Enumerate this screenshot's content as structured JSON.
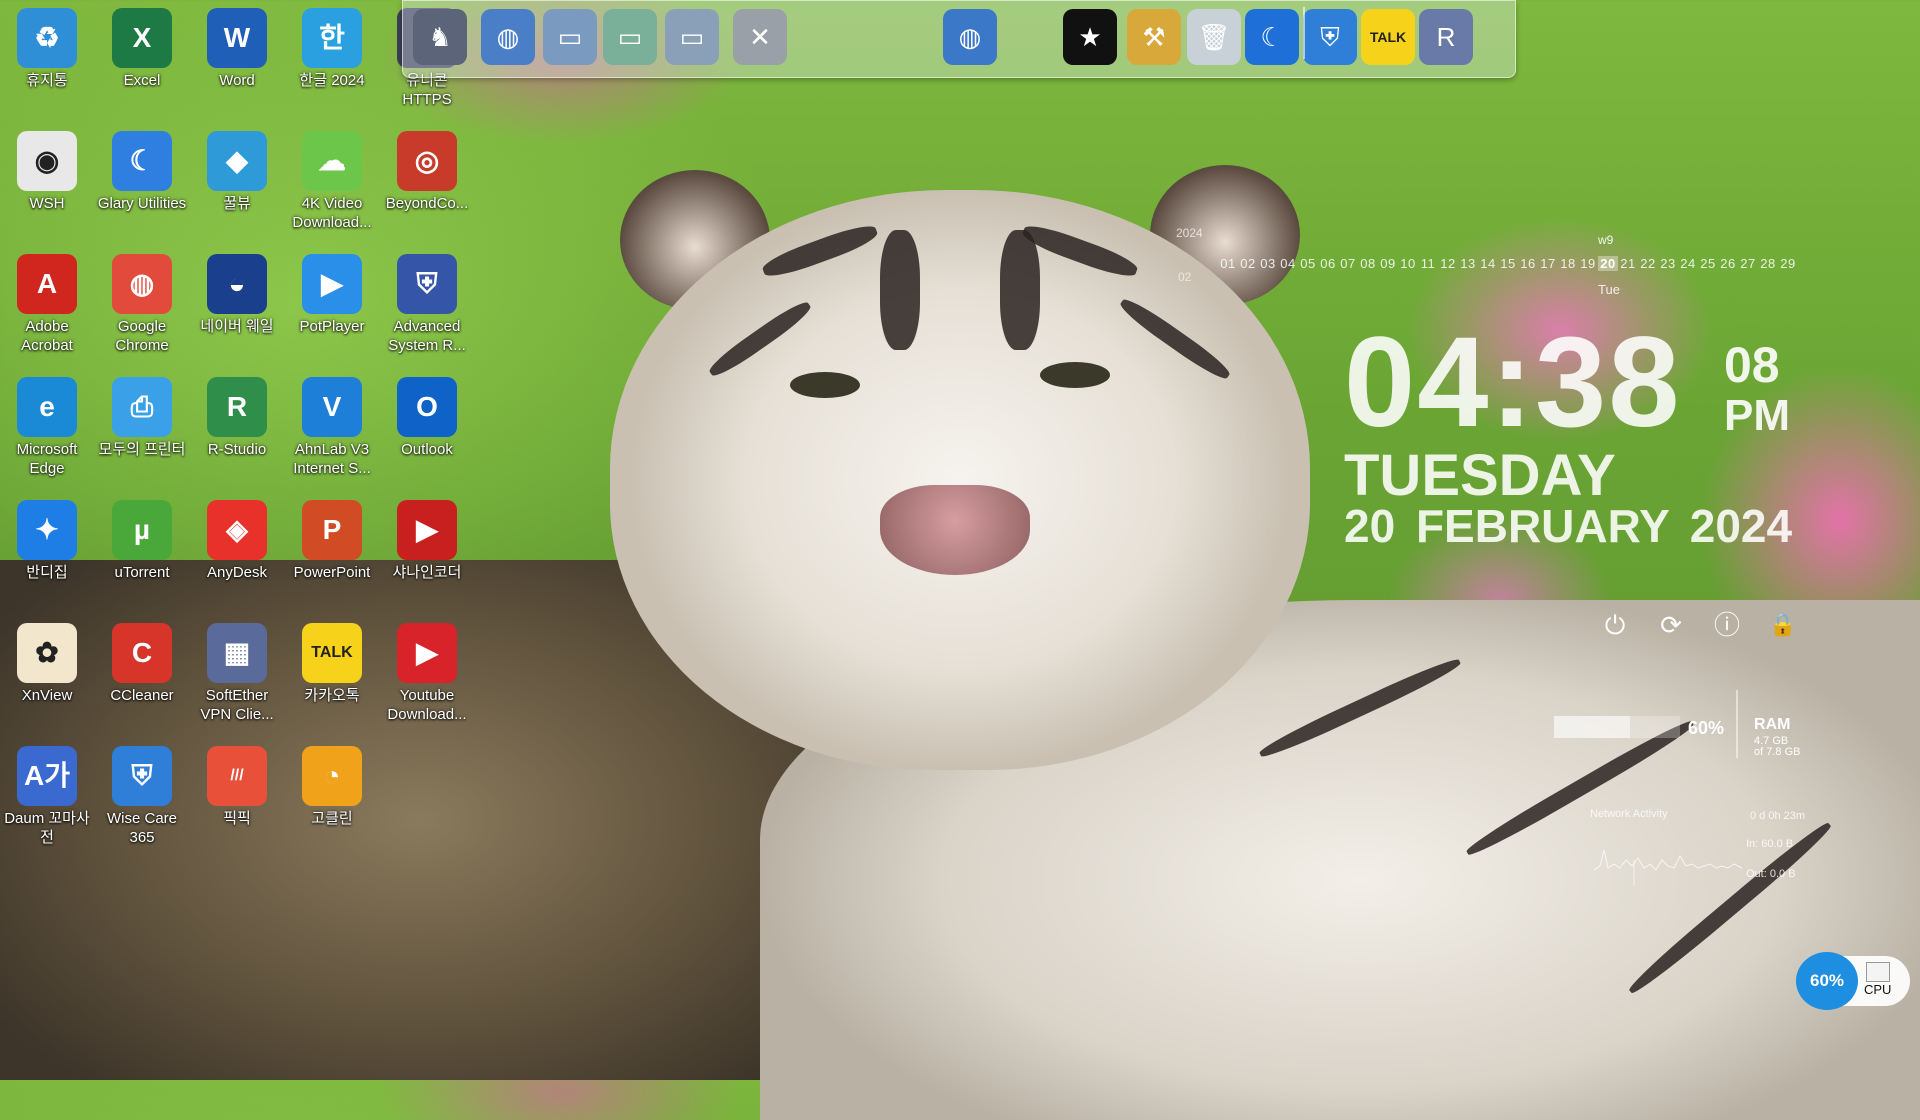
{
  "desktop_icons": [
    {
      "label": "휴지통",
      "icon": "recycle-bin-icon",
      "color": "#2f8fd6",
      "glyph": "♻"
    },
    {
      "label": "Excel",
      "icon": "excel-icon",
      "color": "#1d7a44",
      "glyph": "X"
    },
    {
      "label": "Word",
      "icon": "word-icon",
      "color": "#1f5fb8",
      "glyph": "W"
    },
    {
      "label": "한글 2024",
      "icon": "hangul-icon",
      "color": "#2aa0e0",
      "glyph": "한"
    },
    {
      "label": "유니콘 HTTPS",
      "icon": "unicorn-https-icon",
      "color": "#3a3f58",
      "glyph": "♞"
    },
    {
      "label": "WSH",
      "icon": "wsh-icon",
      "color": "#e8e8e8",
      "glyph": "◉"
    },
    {
      "label": "Glary Utilities",
      "icon": "glary-utilities-icon",
      "color": "#2f7fe0",
      "glyph": "☾"
    },
    {
      "label": "꿀뷰",
      "icon": "honeyview-icon",
      "color": "#2e9bd8",
      "glyph": "◆"
    },
    {
      "label": "4K Video Download...",
      "icon": "4k-video-downloader-icon",
      "color": "#6bc64a",
      "glyph": "☁"
    },
    {
      "label": "BeyondCo...",
      "icon": "beyond-compare-icon",
      "color": "#c83a2a",
      "glyph": "◎"
    },
    {
      "label": "Adobe Acrobat",
      "icon": "adobe-acrobat-icon",
      "color": "#d0261d",
      "glyph": "A"
    },
    {
      "label": "Google Chrome",
      "icon": "chrome-icon",
      "color": "#e24a3b",
      "glyph": "◍"
    },
    {
      "label": "네이버 웨일",
      "icon": "naver-whale-icon",
      "color": "#1a3f8c",
      "glyph": "◒"
    },
    {
      "label": "PotPlayer",
      "icon": "potplayer-icon",
      "color": "#2a8fe8",
      "glyph": "▶"
    },
    {
      "label": "Advanced System R...",
      "icon": "advanced-system-repair-icon",
      "color": "#3556a8",
      "glyph": "⛨"
    },
    {
      "label": "Microsoft Edge",
      "icon": "edge-icon",
      "color": "#1b8ad6",
      "glyph": "e"
    },
    {
      "label": "모두의 프린터",
      "icon": "modu-printer-icon",
      "color": "#3aa0e8",
      "glyph": "⎙"
    },
    {
      "label": "R-Studio",
      "icon": "r-studio-icon",
      "color": "#2f8f4a",
      "glyph": "R"
    },
    {
      "label": "AhnLab V3 Internet S...",
      "icon": "ahnlab-v3-icon",
      "color": "#1e7fd8",
      "glyph": "V"
    },
    {
      "label": "Outlook",
      "icon": "outlook-icon",
      "color": "#0f62c8",
      "glyph": "O"
    },
    {
      "label": "반디집",
      "icon": "bandizip-icon",
      "color": "#1f7ee6",
      "glyph": "✦"
    },
    {
      "label": "uTorrent",
      "icon": "utorrent-icon",
      "color": "#4aa83a",
      "glyph": "µ"
    },
    {
      "label": "AnyDesk",
      "icon": "anydesk-icon",
      "color": "#e8312a",
      "glyph": "◈"
    },
    {
      "label": "PowerPoint",
      "icon": "powerpoint-icon",
      "color": "#d14b24",
      "glyph": "P"
    },
    {
      "label": "샤나인코더",
      "icon": "shana-encoder-icon",
      "color": "#c8201e",
      "glyph": "▶"
    },
    {
      "label": "XnView",
      "icon": "xnview-icon",
      "color": "#f2e6cc",
      "glyph": "✿"
    },
    {
      "label": "CCleaner",
      "icon": "ccleaner-icon",
      "color": "#d8352a",
      "glyph": "C"
    },
    {
      "label": "SoftEther VPN Clie...",
      "icon": "softether-vpn-icon",
      "color": "#5a6a9a",
      "glyph": "▦"
    },
    {
      "label": "카카오톡",
      "icon": "kakaotalk-icon",
      "color": "#f7d21a",
      "glyph": "TALK"
    },
    {
      "label": "Youtube Download...",
      "icon": "youtube-downloader-icon",
      "color": "#d8232a",
      "glyph": "▶"
    },
    {
      "label": "Daum 꼬마사전",
      "icon": "daum-dictionary-icon",
      "color": "#3a6ad0",
      "glyph": "A가"
    },
    {
      "label": "Wise Care 365",
      "icon": "wise-care-icon",
      "color": "#2f7fd8",
      "glyph": "⛨"
    },
    {
      "label": "픽픽",
      "icon": "picpick-icon",
      "color": "#e8503a",
      "glyph": "///"
    },
    {
      "label": "고클린",
      "icon": "goclean-icon",
      "color": "#f0a21a",
      "glyph": "◔"
    }
  ],
  "dock": {
    "items": [
      {
        "icon": "https-app-icon",
        "color": "#5b6478",
        "glyph": "♞"
      },
      {
        "icon": "network-globe-icon",
        "color": "#4a7fc8",
        "glyph": "◍"
      },
      {
        "icon": "folder-icon",
        "color": "#7a9ac0",
        "glyph": "▭"
      },
      {
        "icon": "folder-green-icon",
        "color": "#7ab09a",
        "glyph": "▭"
      },
      {
        "icon": "folder-docs-icon",
        "color": "#8aa0b8",
        "glyph": "▭"
      },
      {
        "icon": "system-tools-icon",
        "color": "#9aa0a8",
        "glyph": "✕"
      },
      {
        "icon": "web-browser-globe-icon",
        "color": "#3b78c8",
        "glyph": "◍"
      },
      {
        "icon": "t-shirt-icon",
        "color": "#111111",
        "glyph": "★"
      },
      {
        "icon": "hammer-tools-icon",
        "color": "#d8a83a",
        "glyph": "⚒"
      },
      {
        "icon": "trash-icon",
        "color": "#c8d0d8",
        "glyph": "🗑"
      },
      {
        "icon": "glary-utilities-icon",
        "color": "#1f6fd8",
        "glyph": "☾"
      },
      {
        "icon": "wise-care-icon",
        "color": "#2f7fd8",
        "glyph": "⛨"
      },
      {
        "icon": "kakaotalk-icon",
        "color": "#f7d21a",
        "glyph": "TALK"
      },
      {
        "icon": "registry-icon",
        "color": "#6a7aa8",
        "glyph": "R"
      }
    ]
  },
  "calendar": {
    "year": "2024",
    "month": "02",
    "week": "w9",
    "days": [
      "01",
      "02",
      "03",
      "04",
      "05",
      "06",
      "07",
      "08",
      "09",
      "10",
      "11",
      "12",
      "13",
      "14",
      "15",
      "16",
      "17",
      "18",
      "19",
      "20",
      "21",
      "22",
      "23",
      "24",
      "25",
      "26",
      "27",
      "28",
      "29"
    ],
    "today": "20",
    "weekday_short": "Tue"
  },
  "clock": {
    "time": "04:38",
    "seconds": "08",
    "ampm": "PM",
    "day": "TUESDAY",
    "date": "20 FEBRUARY  2024"
  },
  "power_buttons": [
    {
      "name": "shutdown-icon",
      "glyph": "⏻"
    },
    {
      "name": "restart-icon",
      "glyph": "⟳"
    },
    {
      "name": "logoff-icon",
      "glyph": "ⓘ"
    },
    {
      "name": "lock-icon",
      "glyph": "🔒"
    }
  ],
  "ram": {
    "percent_label": "60%",
    "percent": 60,
    "label": "RAM",
    "used": "4.7 GB",
    "total": "of 7.8 GB"
  },
  "network": {
    "title": "Network Activity",
    "uptime": "0 d 0h 23m",
    "in": "In: 60.0 B",
    "out": "Out: 0.0 B"
  },
  "cpu": {
    "percent_label": "60%",
    "label": "CPU",
    "accent": "#1e8ee0"
  }
}
